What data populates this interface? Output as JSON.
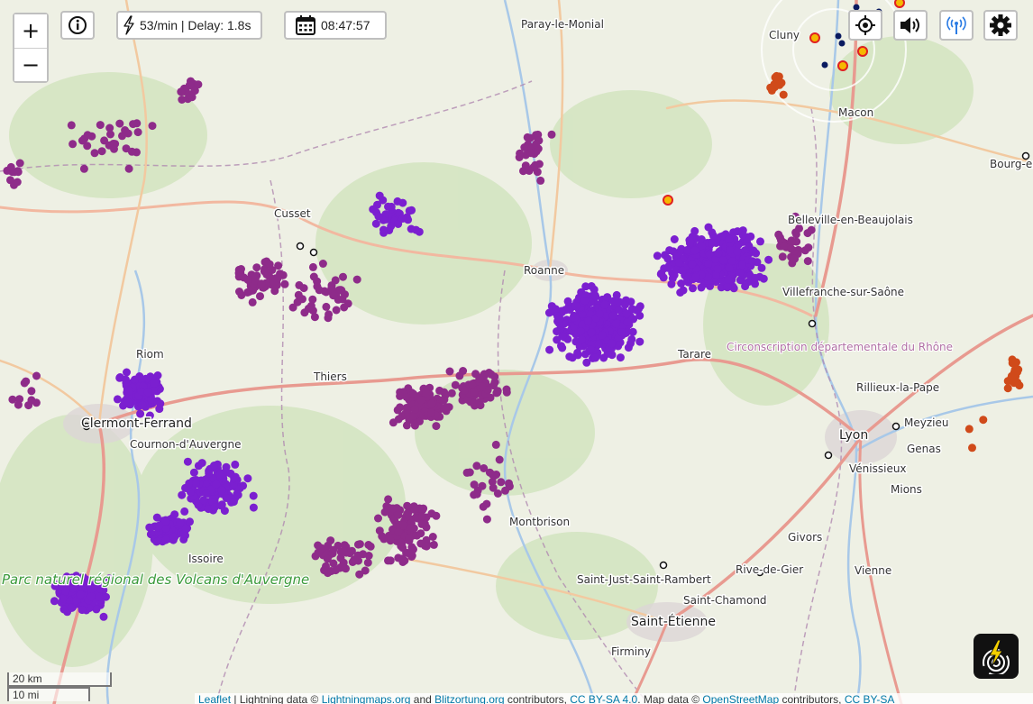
{
  "toolbar": {
    "zoom_in_label": "+",
    "zoom_out_label": "−",
    "rate_text": "53/min | Delay: 1.8s",
    "time_text": "08:47:57"
  },
  "icons": {
    "info": "info-icon",
    "rate": "lightning-bolt-icon",
    "clock": "calendar-icon",
    "locate": "crosshair-icon",
    "sound": "speaker-icon",
    "stations": "antenna-icon",
    "settings": "gear-icon",
    "logo": "lightning-logo-icon"
  },
  "scale": {
    "km": "20 km",
    "mi": "10 mi"
  },
  "attribution": {
    "leaflet": "Leaflet",
    "sep1": " | Lightning data © ",
    "lm": "Lightningmaps.org",
    "and": " and ",
    "bo": "Blitzortung.org",
    "contrib": " contributors, ",
    "license": "CC BY-SA 4.0",
    "mapdata": ". Map data © ",
    "osm": "OpenStreetMap",
    "contrib2": " contributors, ",
    "license2": "CC BY-SA"
  },
  "map": {
    "towns": [
      "Paray-le-Monial",
      "Cluny",
      "Macon",
      "Bourg-en-Bresse",
      "Cusset",
      "Belleville-en-Beaujolais",
      "Roanne",
      "Villefranche-sur-Saône",
      "Riom",
      "Thiers",
      "Tarare",
      "Rillieux-la-Pape",
      "Clermont-Ferrand",
      "Cournon-d'Auvergne",
      "Meyzieu",
      "Lyon",
      "Genas",
      "Vénissieux",
      "Mions",
      "Montbrison",
      "Issoire",
      "Givors",
      "Rive-de-Gier",
      "Vienne",
      "Saint-Just-Saint-Rambert",
      "Saint-Chamond",
      "Saint-Étienne",
      "Firminy"
    ],
    "region_label": "Circonscription départementale du Rhône",
    "park_label": "Parc naturel régional des Volcans d'Auvergne",
    "colors": {
      "strike_recent": "#7b1fd0",
      "strike_mid": "#8e2b8a",
      "strike_older": "#d04a1a",
      "strike_new": "#f5b800",
      "station": "#0a1a60",
      "land": "#eef0e4",
      "forest": "#cfe3bb"
    }
  }
}
